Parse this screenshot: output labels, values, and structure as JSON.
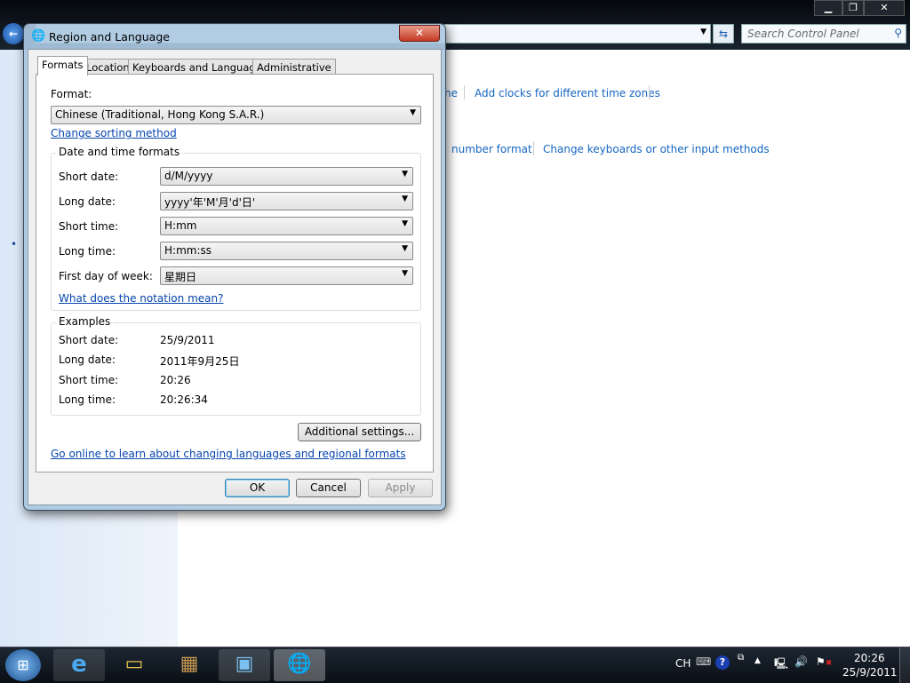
{
  "explorer": {
    "search_placeholder": "Search Control Panel",
    "links": [
      "Add clocks for different time zones",
      "number format",
      "Change keyboards or other input methods"
    ],
    "partial_link": "ne"
  },
  "dialog": {
    "title": "Region and Language",
    "close": "✕",
    "tabs": [
      "Formats",
      "Location",
      "Keyboards and Languages",
      "Administrative"
    ],
    "active_tab": "Formats",
    "format_label": "Format:",
    "format_value": "Chinese (Traditional, Hong Kong S.A.R.)",
    "change_sorting": "Change sorting method",
    "dt_group": "Date and time formats",
    "fields": [
      {
        "label": "Short date:",
        "value": "d/M/yyyy"
      },
      {
        "label": "Long date:",
        "value": "yyyy'年'M'月'd'日'"
      },
      {
        "label": "Short time:",
        "value": "H:mm"
      },
      {
        "label": "Long time:",
        "value": "H:mm:ss"
      },
      {
        "label": "First day of week:",
        "value": "星期日"
      }
    ],
    "notation_link": "What does the notation mean?",
    "examples_group": "Examples",
    "examples": [
      {
        "label": "Short date:",
        "value": "25/9/2011"
      },
      {
        "label": "Long date:",
        "value": "2011年9月25日"
      },
      {
        "label": "Short time:",
        "value": "20:26"
      },
      {
        "label": "Long time:",
        "value": "20:26:34"
      }
    ],
    "additional": "Additional settings...",
    "online_link": "Go online to learn about changing languages and regional formats",
    "ok": "OK",
    "cancel": "Cancel",
    "apply": "Apply"
  },
  "tray": {
    "lang": "CH",
    "time": "20:26",
    "date": "25/9/2011"
  }
}
